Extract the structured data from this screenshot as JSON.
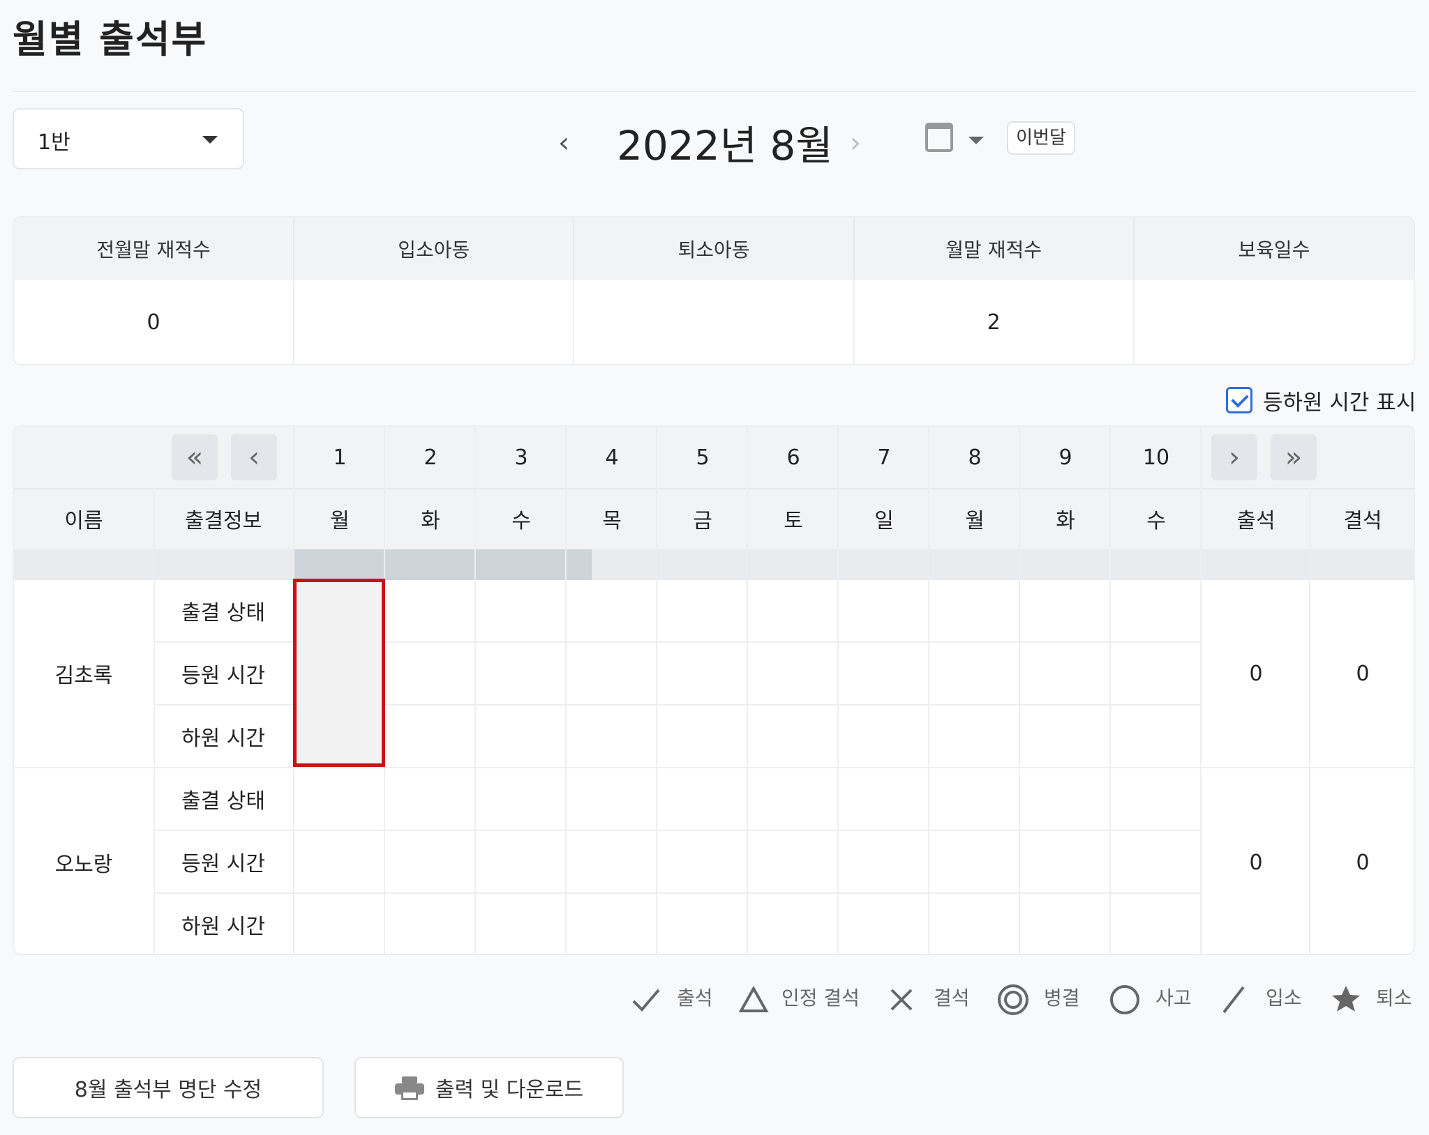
{
  "page": {
    "title": "월별 출석부"
  },
  "filters": {
    "class_value": "1반"
  },
  "month_nav": {
    "prev": "‹",
    "label": "2022년 8월",
    "next": "›",
    "this_month": "이번달"
  },
  "summary": {
    "headers": [
      "전월말 재적수",
      "입소아동",
      "퇴소아동",
      "월말 재적수",
      "보육일수"
    ],
    "values": [
      "0",
      "",
      "",
      "2",
      ""
    ]
  },
  "toggle": {
    "label": "등하원 시간 표시",
    "checked": true
  },
  "grid": {
    "nav": {
      "first": "«",
      "prev": "‹",
      "next": "›",
      "last": "»"
    },
    "days": [
      "1",
      "2",
      "3",
      "4",
      "5",
      "6",
      "7",
      "8",
      "9",
      "10"
    ],
    "weekdays": [
      "월",
      "화",
      "수",
      "목",
      "금",
      "토",
      "일",
      "월",
      "화",
      "수"
    ],
    "headers": {
      "name": "이름",
      "info": "출결정보",
      "present": "출석",
      "absent": "결석"
    },
    "row_labels": [
      "출결 상태",
      "등원 시간",
      "하원 시간"
    ],
    "students": [
      {
        "name": "김초록",
        "present": "0",
        "absent": "0"
      },
      {
        "name": "오노랑",
        "present": "0",
        "absent": "0"
      }
    ]
  },
  "legend": [
    {
      "icon": "check-icon",
      "label": "출석"
    },
    {
      "icon": "triangle-icon",
      "label": "인정 결석"
    },
    {
      "icon": "x-icon",
      "label": "결석"
    },
    {
      "icon": "double-circle-icon",
      "label": "병결"
    },
    {
      "icon": "circle-icon",
      "label": "사고"
    },
    {
      "icon": "slash-icon",
      "label": "입소"
    },
    {
      "icon": "star-icon",
      "label": "퇴소"
    }
  ],
  "actions": {
    "edit_roster": "8월 출석부 명단 수정",
    "print": "출력 및 다운로드"
  },
  "colors": {
    "accent": "#2f6fd8",
    "selection": "#cc1111"
  }
}
